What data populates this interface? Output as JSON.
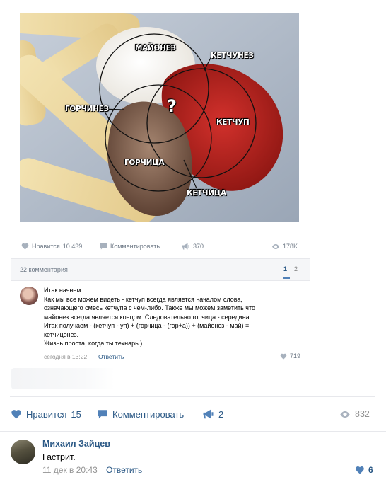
{
  "embedded_post": {
    "image": {
      "labels": {
        "mayonnaise": "МАЙОНЕЗ",
        "ketchunez": "КЕТЧУНЕЗ",
        "gorchinez": "ГОРЧИНЕЗ",
        "center": "?",
        "ketchup": "КЕТЧУП",
        "gorchitsa": "ГОРЧИЦА",
        "ketchitsa": "КЕТЧИЦА"
      }
    },
    "actions": {
      "like_label": "Нравится",
      "like_count": "10 439",
      "comment_label": "Комментировать",
      "share_count": "370",
      "views": "178K"
    },
    "comments_header": {
      "count_label": "22 комментария",
      "pages": [
        "1",
        "2"
      ]
    },
    "comment": {
      "text": "Итак начнем.\nКак мы все можем видеть - кетчуп всегда является началом слова,\nозначающего смесь кетчупа с чем-либо. Также мы можем заметить что\nмайонез всегда является концом. Следовательно горчица - середина.\nИтак получаем - (кетчуп - уп) + (горчица - (гор+а)) + (майонез - май) =\nкетчицонез.\nЖизнь проста, когда ты технарь.)",
      "date": "сегодня в 13:22",
      "reply_label": "Ответить",
      "likes": "719"
    }
  },
  "post_actions": {
    "like_label": "Нравится",
    "like_count": "15",
    "comment_label": "Комментировать",
    "share_count": "2",
    "views": "832"
  },
  "comment": {
    "author": "Михаил Зайцев",
    "text": "Гастрит.",
    "date": "11 дек в 20:43",
    "reply_label": "Ответить",
    "likes": "6"
  },
  "colors": {
    "link": "#2a5885",
    "accent": "#5181b8",
    "muted": "#939393"
  }
}
